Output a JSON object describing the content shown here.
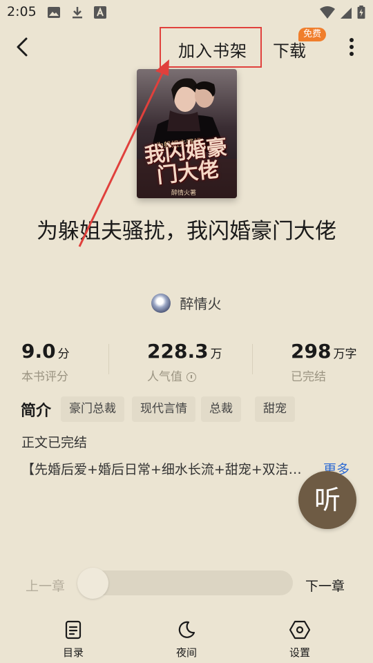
{
  "status_bar": {
    "time": "2:05",
    "icons": [
      "image-icon",
      "download-icon",
      "a-icon",
      "wifi-icon",
      "signal-icon",
      "battery-icon"
    ]
  },
  "top_bar": {
    "add_to_shelf": "加入书架",
    "download": "下载",
    "free_badge": "免费"
  },
  "book": {
    "cover_subtitle": "为躲姐夫骚扰",
    "cover_title": "我闪婚豪门大佬",
    "cover_author": "醉情火著",
    "title": "为躲姐夫骚扰，我闪婚豪门大佬",
    "author": "醉情火"
  },
  "stats": {
    "rating_value": "9.0",
    "rating_unit": "分",
    "rating_label": "本书评分",
    "popularity_value": "228.3",
    "popularity_unit": "万",
    "popularity_label": "人气值",
    "words_value": "298",
    "words_unit": "万字",
    "words_label": "已完结"
  },
  "intro": {
    "heading": "简介",
    "tags": [
      "豪门总裁",
      "现代言情",
      "总裁",
      "甜宠"
    ],
    "status": "正文已完结",
    "synopsis": "【先婚后爱+婚后日常+细水长流+甜宠+双洁…",
    "more": "更多"
  },
  "listen_button": "听",
  "chapter_nav": {
    "prev": "上一章",
    "next": "下一章",
    "progress": 0
  },
  "bottom_nav": {
    "toc": "目录",
    "night": "夜间",
    "settings": "设置"
  },
  "colors": {
    "background": "#ebe4d2",
    "accent_orange": "#f07e2c",
    "link_blue": "#2d6ad3",
    "annotation_red": "#e0403c",
    "listen_brown": "#6e5b44"
  }
}
